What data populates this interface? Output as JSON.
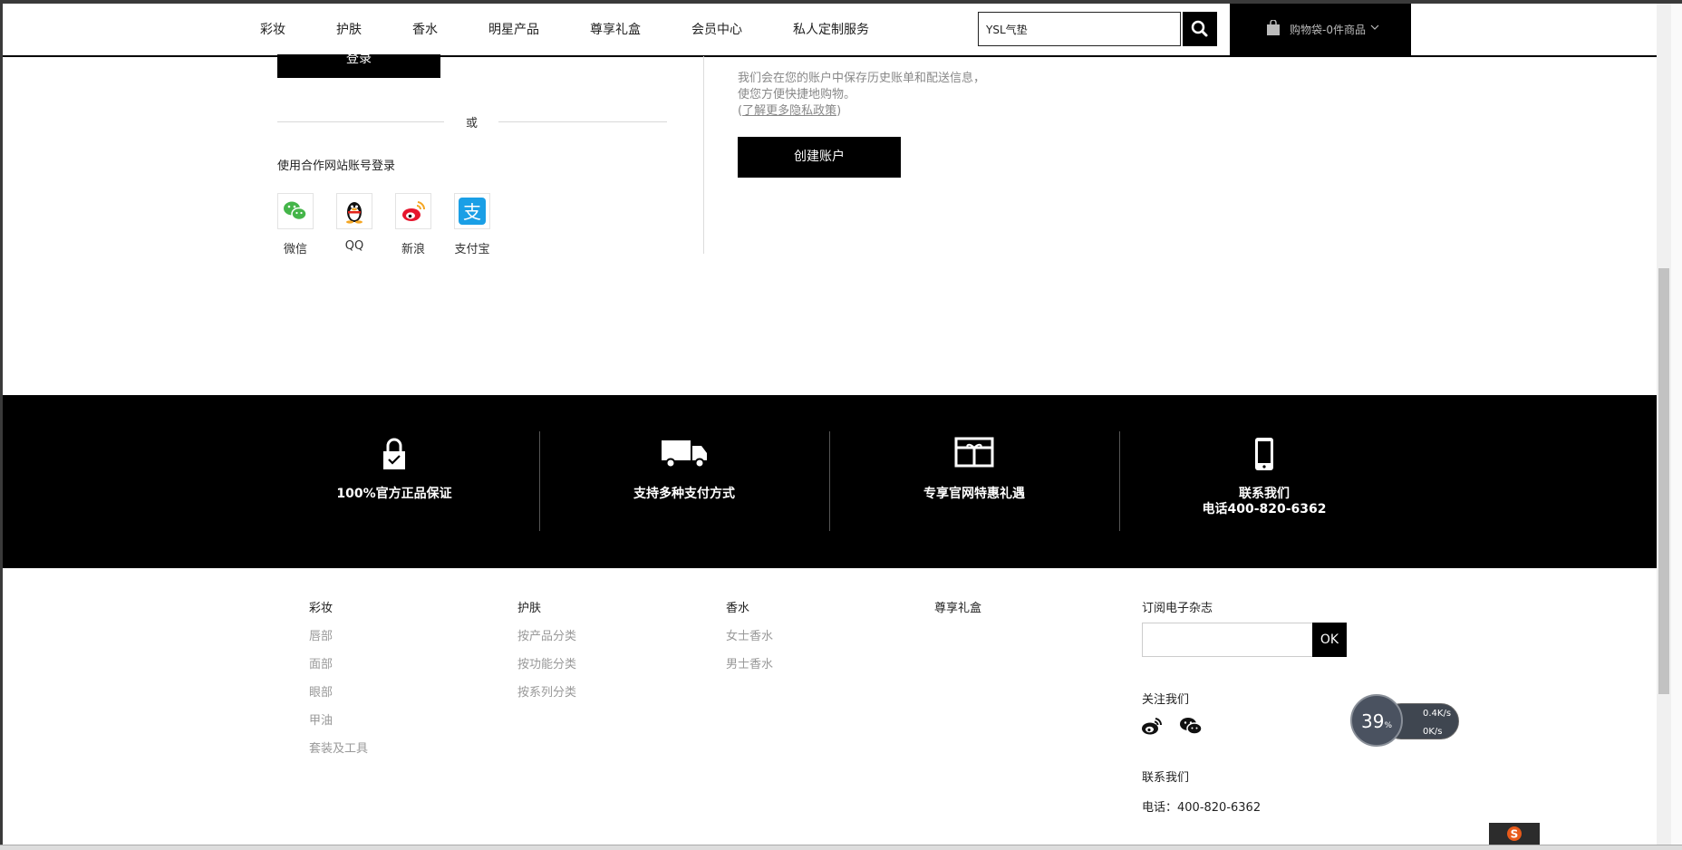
{
  "nav": {
    "items": [
      "彩妆",
      "护肤",
      "香水",
      "明星产品",
      "尊享礼盒",
      "会员中心",
      "私人定制服务"
    ],
    "search_value": "YSL气垫",
    "cart_label": "购物袋-0件商品"
  },
  "login": {
    "login_button": "登录",
    "or_text": "或",
    "partner_title": "使用合作网站账号登录",
    "partners": [
      "微信",
      "QQ",
      "新浪",
      "支付宝"
    ]
  },
  "register": {
    "text_line1": "我们会在您的账户中保存历史账单和配送信息，",
    "text_line2": "使您方便快捷地购物。",
    "paren_open": "(",
    "privacy_link": "了解更多隐私政策",
    "paren_close": ")",
    "create_button": "创建账户"
  },
  "band": {
    "items": [
      {
        "icon": "lock-icon",
        "text": "100%官方正品保证"
      },
      {
        "icon": "truck-icon",
        "text": "支持多种支付方式"
      },
      {
        "icon": "gift-icon",
        "text": "专享官网特惠礼遇"
      },
      {
        "icon": "phone-icon",
        "text": "联系我们",
        "subtext": "电话400-820-6362"
      }
    ]
  },
  "footer": {
    "columns": [
      {
        "title": "彩妆",
        "links": [
          "唇部",
          "面部",
          "眼部",
          "甲油",
          "套装及工具"
        ]
      },
      {
        "title": "护肤",
        "links": [
          "按产品分类",
          "按功能分类",
          "按系列分类"
        ]
      },
      {
        "title": "香水",
        "links": [
          "女士香水",
          "男士香水"
        ]
      },
      {
        "title": "尊享礼盒",
        "links": []
      }
    ],
    "subscribe_title": "订阅电子杂志",
    "subscribe_button": "OK",
    "follow_title": "关注我们",
    "contact_title": "联系我们",
    "contact_phone": "电话：400-820-6362"
  },
  "speed_widget": {
    "percent": "39",
    "percent_unit": "%",
    "up": "0.4K/s",
    "down": "0K/s"
  },
  "colors": {
    "primary": "#000000",
    "muted": "#999999",
    "background": "#ffffff"
  }
}
